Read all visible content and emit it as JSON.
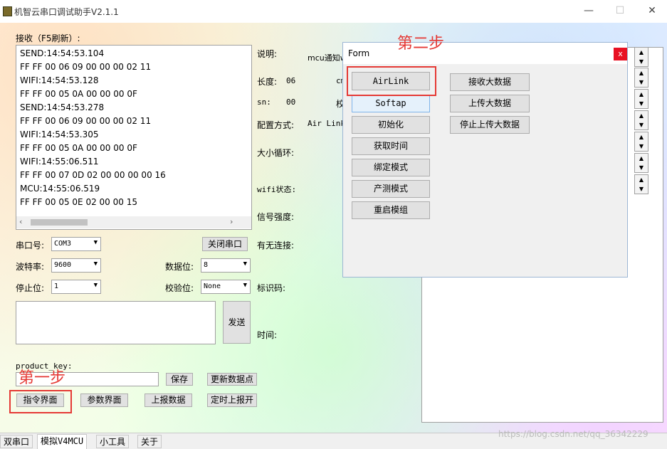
{
  "window": {
    "title": "机智云串口调试助手V2.1.1",
    "min": "—",
    "max": "☐",
    "close": "✕"
  },
  "receive": {
    "label": "接收（F5刷新）:",
    "lines": [
      "SEND:14:54:53.104",
      "FF FF 00 06 09 00 00 00 02 11",
      "WIFI:14:54:53.128",
      "FF FF 00 05 0A 00 00 00 0F",
      "SEND:14:54:53.278",
      "FF FF 00 06 09 00 00 00 02 11",
      "WIFI:14:54:53.305",
      "FF FF 00 05 0A 00 00 00 0F",
      "WIFI:14:55:06.511",
      "FF FF 00 07 0D 02 00 00 00 00 16",
      "MCU:14:55:06.519",
      "FF FF 00 05 0E 02 00 00 15"
    ]
  },
  "serial": {
    "port_label": "串口号:",
    "port_value": "COM3",
    "close_port": "关闭串口",
    "baud_label": "波特率:",
    "baud_value": "9600",
    "databits_label": "数据位:",
    "databits_value": "8",
    "stopbits_label": "停止位:",
    "stopbits_value": "1",
    "parity_label": "校验位:",
    "parity_value": "None",
    "send_button": "发送"
  },
  "product": {
    "label": "product_key:",
    "save": "保存",
    "update": "更新数据点"
  },
  "bottom_buttons": {
    "cmd": "指令界面",
    "param": "参数界面",
    "report": "上报数据",
    "timer": "定时上报开"
  },
  "steps": {
    "step1": "第一步",
    "step2": "第二步"
  },
  "info": {
    "desc_label": "说明:",
    "desc_value": "mcu通知w",
    "len_label": "长度:",
    "len_value": "06",
    "len_extra": "cm",
    "sn_label": "sn:",
    "sn_value": "00",
    "sn_extra": "校",
    "mode_label": "配置方式:",
    "mode_value": "Air Link",
    "loop_label": "大小循环:",
    "wifi_label": "wifi状态:",
    "signal_label": "信号强度:",
    "conn_label": "有无连接:",
    "id_label": "标识码:",
    "time_label": "时间:"
  },
  "form": {
    "title": "Form",
    "close": "x",
    "left_buttons": [
      "AirLink",
      "Softap",
      "初始化",
      "获取时间",
      "绑定模式",
      "产测模式",
      "重启模组"
    ],
    "right_buttons": [
      "接收大数据",
      "上传大数据",
      "停止上传大数据"
    ]
  },
  "tabs": [
    "双串口",
    "模拟V4MCU",
    "小工具",
    "关于"
  ],
  "watermark": "https://blog.csdn.net/qq_36342229"
}
